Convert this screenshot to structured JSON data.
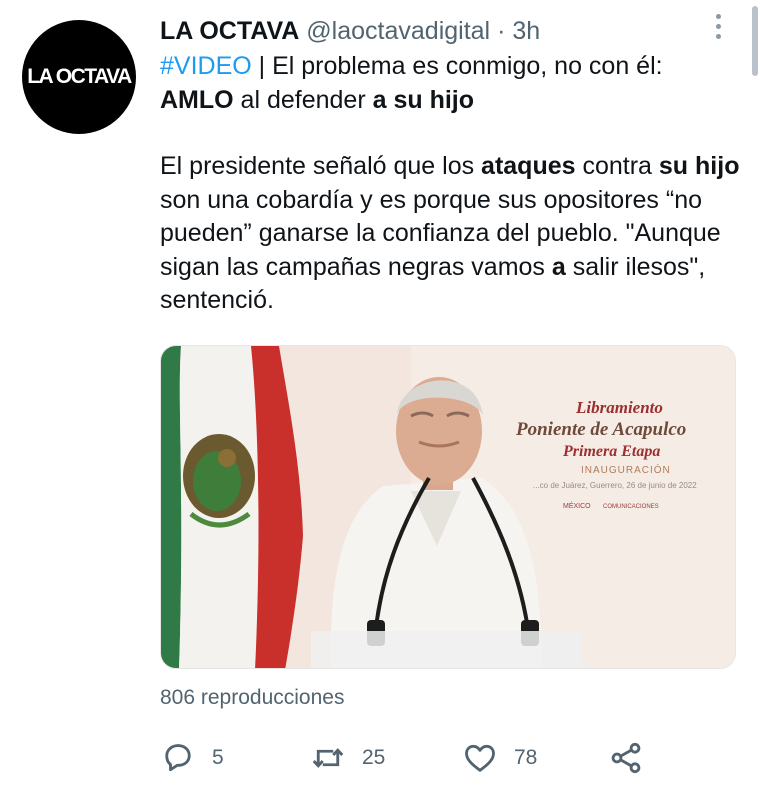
{
  "tweet": {
    "avatar_text": "LA OCTAVA",
    "display_name": "LA OCTAVA",
    "handle": "@laoctavadigital",
    "separator": "·",
    "time": "3h",
    "line1": {
      "hashtag": "#VIDEO",
      "rest": " | El problema es conmigo, no con él:"
    },
    "line2": {
      "s1": "AMLO",
      "s2": " al defender ",
      "s3": "a su hijo"
    },
    "para2": {
      "s1": "El presidente señaló que los ",
      "s2": "ataques",
      "s3": " contra ",
      "s4": "su hijo",
      "s5": " son una cobardía y es porque sus opositores “no pueden” ganarse la confianza del pueblo. \"Aunque sigan las campañas negras vamos ",
      "s6": "a",
      "s7": " salir ilesos\", sentenció."
    },
    "media": {
      "banner_line1": "Libramiento",
      "banner_line2": "Poniente de Acapulco",
      "banner_line3": "Primera Etapa",
      "banner_line4": "INAUGURACIÓN",
      "banner_line5": "...co de Juárez, Guerrero, 26 de junio de 2022",
      "logo_1": "MÉXICO",
      "logo_2": "COMUNICACIONES"
    },
    "views": "806 reproducciones",
    "actions": {
      "reply_count": "5",
      "retweet_count": "25",
      "like_count": "78"
    }
  },
  "colors": {
    "hashtag": "#1d9bf0",
    "secondary_text": "#536471",
    "primary_text": "#0f1419"
  }
}
